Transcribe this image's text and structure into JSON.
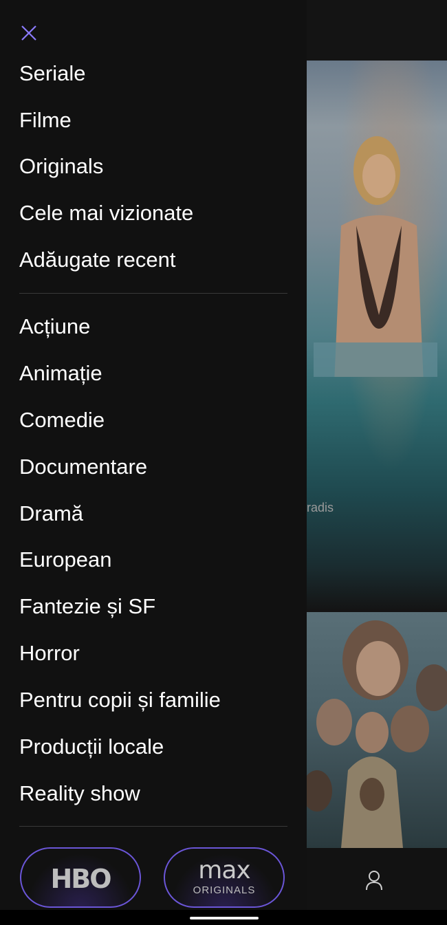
{
  "drawer": {
    "primary_items": [
      {
        "label": "Seriale"
      },
      {
        "label": "Filme"
      },
      {
        "label": "Originals"
      },
      {
        "label": "Cele mai vizionate"
      },
      {
        "label": "Adăugate recent"
      }
    ],
    "genre_items": [
      {
        "label": "Acțiune"
      },
      {
        "label": "Animație"
      },
      {
        "label": "Comedie"
      },
      {
        "label": "Documentare"
      },
      {
        "label": "Dramă"
      },
      {
        "label": "European"
      },
      {
        "label": "Fantezie și SF"
      },
      {
        "label": "Horror"
      },
      {
        "label": "Pentru copii și familie"
      },
      {
        "label": "Producții locale"
      },
      {
        "label": "Reality show"
      }
    ],
    "brands": {
      "hbo": "HBO",
      "max_top": "max",
      "max_bottom": "ORIGINALS"
    }
  },
  "background": {
    "poster_caption_fragment": "radis"
  },
  "icons": {
    "close": "close-icon",
    "profile": "profile-icon"
  },
  "colors": {
    "accent": "#6b56d8",
    "drawer_bg": "#111111",
    "text": "#ffffff",
    "divider": "#3a3a3a"
  }
}
